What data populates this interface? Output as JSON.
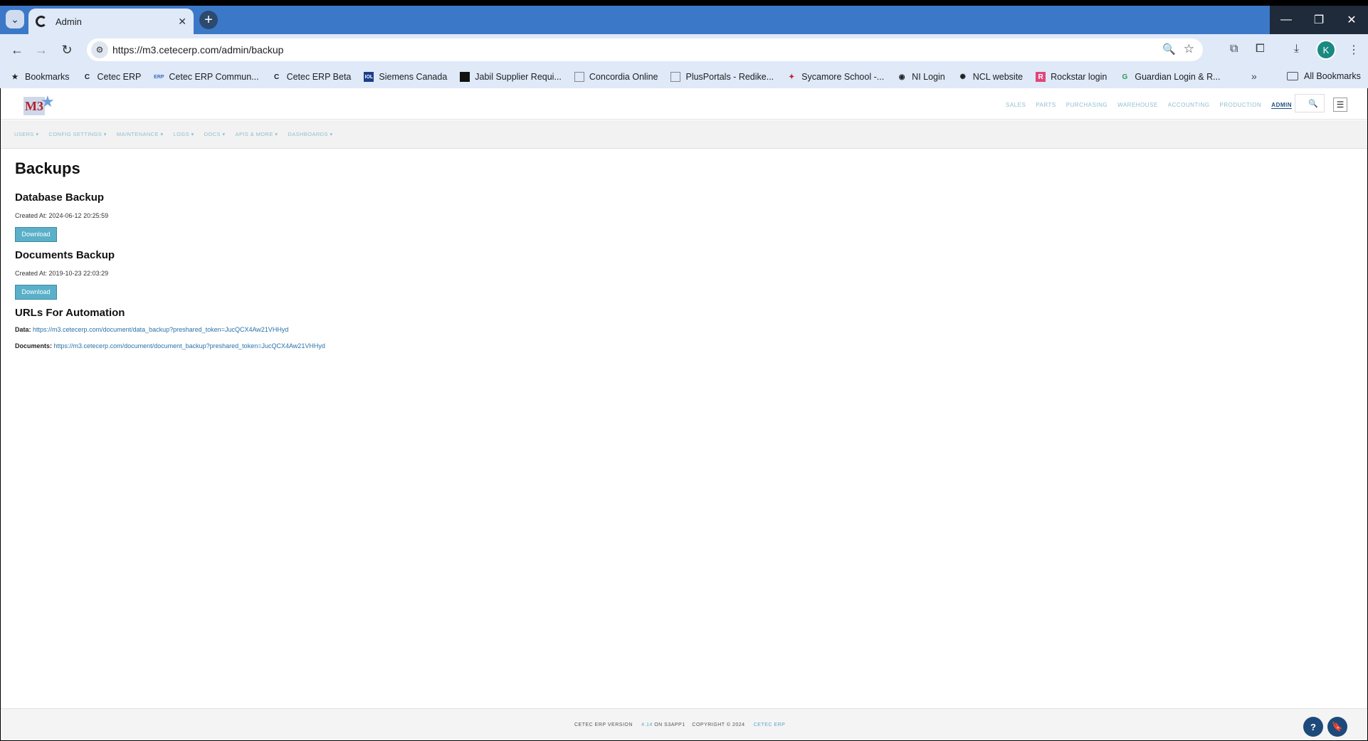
{
  "browser": {
    "tab_title": "Admin",
    "url": "https://m3.cetecerp.com/admin/backup",
    "profile_initial": "K",
    "bookmarks": [
      "Bookmarks",
      "Cetec ERP",
      "Cetec ERP Commun...",
      "Cetec ERP Beta",
      "Siemens Canada",
      "Jabil Supplier Requi...",
      "Concordia Online",
      "PlusPortals - Redike...",
      "Sycamore School -...",
      "NI Login",
      "NCL website",
      "Rockstar login",
      "Guardian Login & R..."
    ],
    "all_bookmarks": "All Bookmarks"
  },
  "app": {
    "logo_text": "M3",
    "top_nav": [
      "SALES",
      "PARTS",
      "PURCHASING",
      "WAREHOUSE",
      "ACCOUNTING",
      "PRODUCTION",
      "ADMIN"
    ],
    "active_top_nav": "ADMIN",
    "sub_nav": [
      "USERS ▾",
      "CONFIG SETTINGS ▾",
      "MAINTENANCE ▾",
      "LOGS ▾",
      "DOCS ▾",
      "APIS & MORE ▾",
      "DASHBOARDS ▾"
    ]
  },
  "content": {
    "title": "Backups",
    "db_backup": {
      "heading": "Database Backup",
      "created": "Created At: 2024-06-12 20:25:59",
      "button": "Download"
    },
    "docs_backup": {
      "heading": "Documents Backup",
      "created": "Created At: 2019-10-23 22:03:29",
      "button": "Download"
    },
    "automation": {
      "heading": "URLs For Automation",
      "data_label": "Data:",
      "data_url": "https://m3.cetecerp.com/document/data_backup?preshared_token=JucQCX4Aw21VHHyd",
      "docs_label": "Documents:",
      "docs_url": "https://m3.cetecerp.com/document/document_backup?preshared_token=JucQCX4Aw21VHHyd"
    }
  },
  "footer": {
    "version_label": "CETEC ERP VERSION",
    "version": "4.14",
    "server": "ON S3APP1",
    "copyright": "COPYRIGHT © 2024",
    "company": "CETEC ERP"
  }
}
